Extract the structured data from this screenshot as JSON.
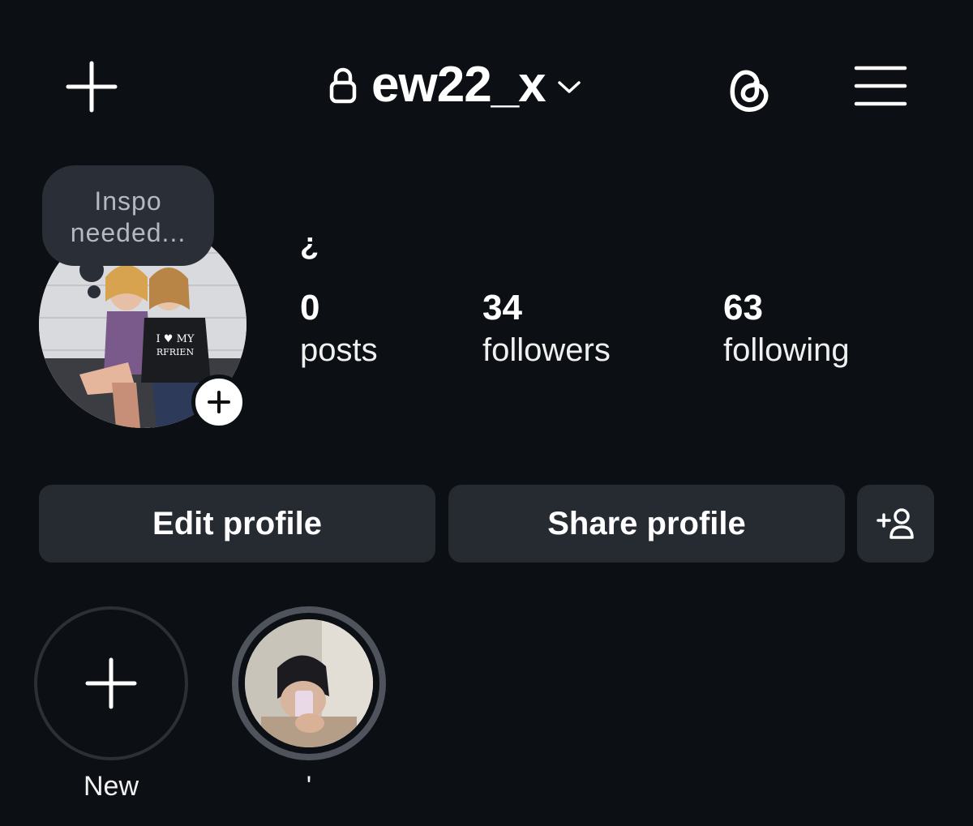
{
  "header": {
    "username": "ew22_x",
    "lock_icon": "lock-icon",
    "dropdown_icon": "chevron-down-icon",
    "create_icon": "plus-icon",
    "threads_icon": "threads-icon",
    "menu_icon": "hamburger-menu-icon"
  },
  "note": {
    "line1": "Inspo",
    "line2": "needed..."
  },
  "profile": {
    "display_name": "¿",
    "stats": {
      "posts_count": "0",
      "posts_label": "posts",
      "followers_count": "34",
      "followers_label": "followers",
      "following_count": "63",
      "following_label": "following"
    }
  },
  "buttons": {
    "edit_profile": "Edit profile",
    "share_profile": "Share profile",
    "add_person_icon": "add-person-icon"
  },
  "highlights": [
    {
      "label": "New",
      "icon": "plus-icon"
    },
    {
      "label": "'"
    }
  ],
  "colors": {
    "background": "#0c0f14",
    "button_bg": "#262a31",
    "note_bg": "#2a2e36",
    "text": "#ffffff"
  }
}
